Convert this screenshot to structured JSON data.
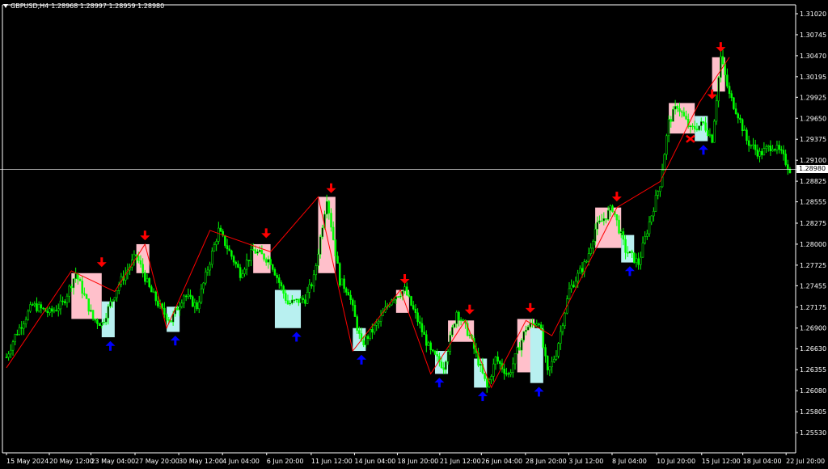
{
  "header": {
    "symbol_timeframe": "GBPUSD,H4",
    "ohlc": "1.28968 1.28997 1.28959 1.28980"
  },
  "colors": {
    "background": "#000000",
    "candles": "#00ff00",
    "zigzag": "#ff0000",
    "supply_zone": "#ffc0cb",
    "demand_zone": "#b8f0f0",
    "sell_arrow": "#ff0000",
    "buy_arrow": "#0000ff",
    "grid_line": "#ffffff"
  },
  "chart_data": {
    "type": "candlestick",
    "symbol": "GBPUSD",
    "timeframe": "H4",
    "current_price": "1.28980",
    "y_ticks": [
      "1.31020",
      "1.30745",
      "1.30470",
      "1.30195",
      "1.29925",
      "1.29650",
      "1.29375",
      "1.29100",
      "1.28825",
      "1.28555",
      "1.28275",
      "1.28000",
      "1.27725",
      "1.27455",
      "1.27175",
      "1.26900",
      "1.26630",
      "1.26355",
      "1.26080",
      "1.25805",
      "1.25530"
    ],
    "y_values": [
      1.3102,
      1.30745,
      1.3047,
      1.30195,
      1.29925,
      1.2965,
      1.29375,
      1.291,
      1.28825,
      1.28555,
      1.28275,
      1.28,
      1.27725,
      1.27455,
      1.27175,
      1.269,
      1.2663,
      1.26355,
      1.2608,
      1.25805,
      1.2553
    ],
    "x_ticks": [
      "15 May 2024",
      "20 May 12:00",
      "23 May 04:00",
      "27 May 20:00",
      "30 May 12:00",
      "4 Jun 04:00",
      "6 Jun 20:00",
      "11 Jun 12:00",
      "14 Jun 04:00",
      "18 Jun 20:00",
      "21 Jun 12:00",
      "26 Jun 04:00",
      "28 Jun 20:00",
      "3 Jul 12:00",
      "8 Jul 04:00",
      "10 Jul 20:00",
      "15 Jul 12:00",
      "18 Jul 04:00",
      "22 Jul 20:00"
    ],
    "x_tick_index": [
      0,
      9.9,
      19.5,
      29.7,
      39.8,
      49.9,
      60.1,
      70.4,
      80.4,
      90.3,
      100.1,
      109.7,
      119.9,
      129.9,
      139.9,
      150.2,
      160.6,
      170.1,
      180.1
    ],
    "index_max": 181,
    "price_path": [
      [
        0,
        1.2652
      ],
      [
        2,
        1.268
      ],
      [
        6,
        1.272
      ],
      [
        10,
        1.271
      ],
      [
        13,
        1.2722
      ],
      [
        16,
        1.2762
      ],
      [
        20,
        1.2702
      ],
      [
        22,
        1.2696
      ],
      [
        26,
        1.2748
      ],
      [
        30,
        1.2785
      ],
      [
        33,
        1.2742
      ],
      [
        36,
        1.2712
      ],
      [
        38,
        1.27
      ],
      [
        41,
        1.2734
      ],
      [
        44,
        1.2718
      ],
      [
        49,
        1.2818
      ],
      [
        54,
        1.2762
      ],
      [
        57,
        1.2792
      ],
      [
        61,
        1.2778
      ],
      [
        65,
        1.2722
      ],
      [
        69,
        1.2728
      ],
      [
        71,
        1.2755
      ],
      [
        74,
        1.2862
      ],
      [
        77,
        1.2752
      ],
      [
        79,
        1.2738
      ],
      [
        82,
        1.2668
      ],
      [
        86,
        1.2698
      ],
      [
        89,
        1.273
      ],
      [
        92,
        1.274
      ],
      [
        95,
        1.27
      ],
      [
        98,
        1.2658
      ],
      [
        101,
        1.264
      ],
      [
        104,
        1.2712
      ],
      [
        107,
        1.268
      ],
      [
        111,
        1.2612
      ],
      [
        113,
        1.265
      ],
      [
        116,
        1.2628
      ],
      [
        120,
        1.269
      ],
      [
        123,
        1.27
      ],
      [
        125,
        1.263
      ],
      [
        127,
        1.2658
      ],
      [
        130,
        1.274
      ],
      [
        134,
        1.2778
      ],
      [
        136,
        1.282
      ],
      [
        140,
        1.2848
      ],
      [
        143,
        1.2792
      ],
      [
        146,
        1.2775
      ],
      [
        148,
        1.2818
      ],
      [
        151,
        1.288
      ],
      [
        153,
        1.296
      ],
      [
        155,
        1.2982
      ],
      [
        158,
        1.295
      ],
      [
        161,
        1.2958
      ],
      [
        163,
        1.2938
      ],
      [
        165,
        1.3045
      ],
      [
        167,
        1.2995
      ],
      [
        169,
        1.297
      ],
      [
        171,
        1.2936
      ],
      [
        174,
        1.2918
      ],
      [
        177,
        1.293
      ],
      [
        179,
        1.2918
      ],
      [
        181,
        1.2898
      ]
    ],
    "zigzag": [
      [
        0,
        1.2638
      ],
      [
        15,
        1.2765
      ],
      [
        25,
        1.2738
      ],
      [
        32,
        1.28
      ],
      [
        37,
        1.269
      ],
      [
        47,
        1.2818
      ],
      [
        61,
        1.279
      ],
      [
        72,
        1.2862
      ],
      [
        80,
        1.266
      ],
      [
        91,
        1.274
      ],
      [
        98,
        1.263
      ],
      [
        106,
        1.27
      ],
      [
        112,
        1.2612
      ],
      [
        120,
        1.27
      ],
      [
        126,
        1.268
      ],
      [
        141,
        1.2848
      ],
      [
        151,
        1.2882
      ],
      [
        160,
        1.2985
      ],
      [
        167,
        1.3045
      ]
    ],
    "supply_zones": [
      [
        15,
        22,
        1.2762,
        1.2702
      ],
      [
        30,
        33,
        1.28,
        1.2762
      ],
      [
        57,
        61,
        1.28,
        1.2762
      ],
      [
        72,
        76,
        1.2862,
        1.2762
      ],
      [
        90,
        93,
        1.274,
        1.271
      ],
      [
        102,
        108,
        1.27,
        1.2672
      ],
      [
        118,
        122,
        1.2702,
        1.2632
      ],
      [
        136,
        142,
        1.2848,
        1.2795
      ],
      [
        153,
        159,
        1.2985,
        1.2945
      ],
      [
        163,
        166,
        1.3045,
        1.3
      ]
    ],
    "demand_zones": [
      [
        22,
        25,
        1.2725,
        1.2678
      ],
      [
        37,
        40,
        1.2718,
        1.2685
      ],
      [
        62,
        68,
        1.274,
        1.269
      ],
      [
        80,
        83,
        1.269,
        1.266
      ],
      [
        99,
        102,
        1.266,
        1.263
      ],
      [
        108,
        111,
        1.265,
        1.2612
      ],
      [
        121,
        124,
        1.269,
        1.2618
      ],
      [
        142,
        145,
        1.2812,
        1.2776
      ],
      [
        159,
        162,
        1.2968,
        1.2935
      ]
    ],
    "sell_arrows": [
      [
        22,
        1.277
      ],
      [
        32,
        1.2805
      ],
      [
        60,
        1.2808
      ],
      [
        75,
        1.2867
      ],
      [
        92,
        1.2748
      ],
      [
        107,
        1.2708
      ],
      [
        121,
        1.271
      ],
      [
        141,
        1.2856
      ],
      [
        163,
        1.299
      ],
      [
        165,
        1.3052
      ]
    ],
    "buy_arrows": [
      [
        24,
        1.2673
      ],
      [
        39,
        1.268
      ],
      [
        67,
        1.2685
      ],
      [
        82,
        1.2655
      ],
      [
        100,
        1.2625
      ],
      [
        110,
        1.2607
      ],
      [
        123,
        1.2613
      ],
      [
        144,
        1.2771
      ],
      [
        161,
        1.293
      ]
    ],
    "cross_marks": [
      [
        158,
        1.2938
      ]
    ]
  }
}
